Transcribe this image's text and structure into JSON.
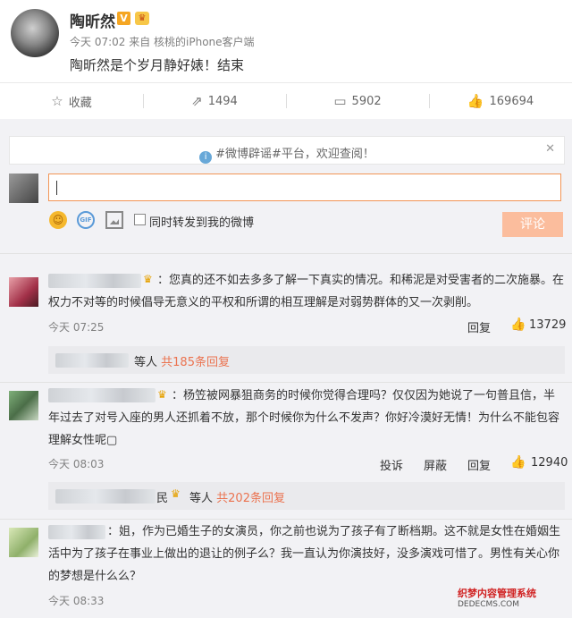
{
  "post": {
    "author": "陶昕然",
    "vip_badge": "V",
    "meta": "今天 07:02 来自 核桃的iPhone客户端",
    "content": "陶昕然是个岁月静好婊！结束"
  },
  "actions": {
    "favorite": "收藏",
    "repost": "1494",
    "comment": "5902",
    "like": "169694"
  },
  "notice": {
    "text": "#微博辟谣#平台，欢迎查阅！",
    "close": "✕"
  },
  "composer": {
    "sync_label": "同时转发到我的微博",
    "submit": "评论",
    "gif": "GIF"
  },
  "comments": [
    {
      "text": "：您真的还不如去多多了解一下真实的情况。和稀泥是对受害者的二次施暴。在权力不对等的时候倡导无意义的平权和所谓的相互理解是对弱势群体的又一次剥削。",
      "time": "今天 07:25",
      "reply": "回复",
      "likes": "13729",
      "sub_label": "等人",
      "sub_link": "共185条回复"
    },
    {
      "text": "：杨笠被网暴狙商务的时候你觉得合理吗？仅仅因为她说了一句普且信，半年过去了对号入座的男人还抓着不放，那个时候你为什么不发声？你好冷漠好无情！为什么不能包容理解女性呢▢",
      "time": "今天 08:03",
      "report": "投诉",
      "block": "屏蔽",
      "reply": "回复",
      "likes": "12940",
      "sub_prefix": "民",
      "sub_label": "等人",
      "sub_link": "共202条回复"
    },
    {
      "text": "：姐，作为已婚生子的女演员，你之前也说为了孩子有了断档期。这不就是女性在婚姻生活中为了孩子在事业上做出的退让的例子么？我一直认为你演技好，没多演戏可惜了。男性有关心你的梦想是什么么？",
      "time": "今天 08:33"
    }
  ],
  "watermark": {
    "line1": "织梦内容管理系统",
    "line2": "DEDECMS.COM"
  },
  "colors": {
    "accent": "#eb7350",
    "submit_disabled": "#fbbd9d",
    "input_border": "#f29455",
    "vip": "#f5a623"
  }
}
